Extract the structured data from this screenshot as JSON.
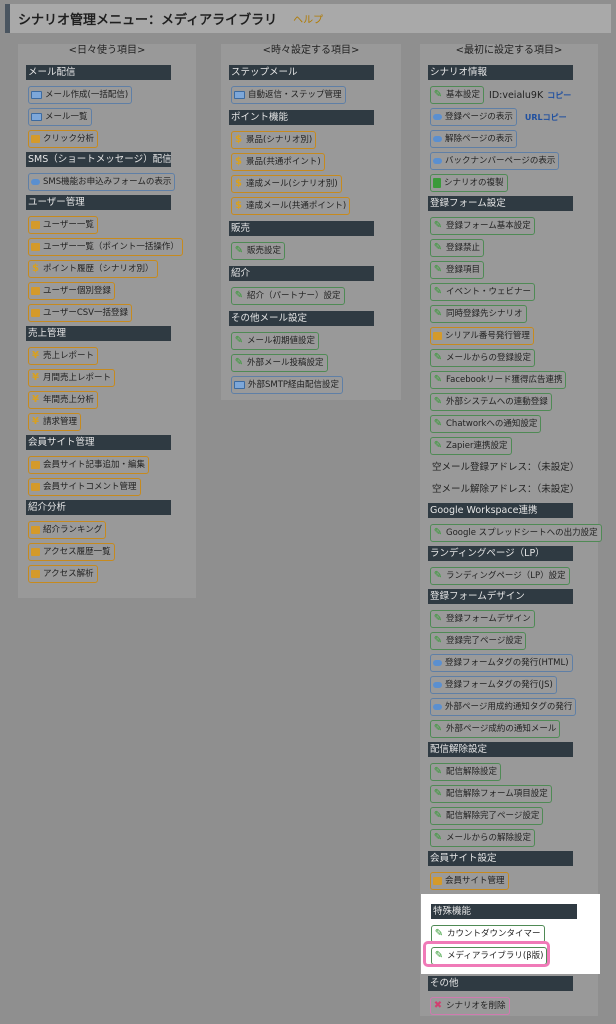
{
  "header": {
    "title": "シナリオ管理メニュー：メディアライブラリ",
    "help": "ヘルプ"
  },
  "columns": [
    {
      "heading": "<日々使う項目>",
      "sections": [
        {
          "title": "メール配信",
          "items": [
            {
              "label": "メール作成(一括配信)",
              "icon": "mail-icon",
              "style": "blue"
            },
            {
              "label": "メール一覧",
              "icon": "mail-icon",
              "style": "blue"
            },
            {
              "label": "クリック分析",
              "icon": "chart-icon",
              "style": "orange"
            }
          ]
        },
        {
          "title": "SMS（ショートメッセージ）配信",
          "items": [
            {
              "label": "SMS機能お申込みフォームの表示",
              "icon": "arrow-icon",
              "style": "blue"
            }
          ]
        },
        {
          "title": "ユーザー管理",
          "items": [
            {
              "label": "ユーザー一覧",
              "icon": "chart-icon",
              "style": "orange"
            },
            {
              "label": "ユーザー一覧（ポイント一括操作）",
              "icon": "chart-icon",
              "style": "orange"
            },
            {
              "label": "ポイント履歴（シナリオ別）",
              "icon": "dollar-icon",
              "style": "orange"
            },
            {
              "label": "ユーザー個別登録",
              "icon": "chart-icon",
              "style": "orange"
            },
            {
              "label": "ユーザーCSV一括登録",
              "icon": "chart-icon",
              "style": "orange"
            }
          ]
        },
        {
          "title": "売上管理",
          "items": [
            {
              "label": "売上レポート",
              "icon": "yen-icon",
              "style": "orange"
            },
            {
              "label": "月間売上レポート",
              "icon": "yen-icon",
              "style": "orange"
            },
            {
              "label": "年間売上分析",
              "icon": "yen-icon",
              "style": "orange"
            },
            {
              "label": "請求管理",
              "icon": "yen-icon",
              "style": "orange"
            }
          ]
        },
        {
          "title": "会員サイト管理",
          "items": [
            {
              "label": "会員サイト記事追加・編集",
              "icon": "chart-icon",
              "style": "orange"
            },
            {
              "label": "会員サイトコメント管理",
              "icon": "chart-icon",
              "style": "orange"
            }
          ]
        },
        {
          "title": "紹介分析",
          "items": [
            {
              "label": "紹介ランキング",
              "icon": "chart-icon",
              "style": "orange"
            },
            {
              "label": "アクセス履歴一覧",
              "icon": "chart-icon",
              "style": "orange"
            },
            {
              "label": "アクセス解析",
              "icon": "chart-icon",
              "style": "orange"
            }
          ]
        }
      ]
    },
    {
      "heading": "<時々設定する項目>",
      "sections": [
        {
          "title": "ステップメール",
          "items": [
            {
              "label": "自動返信・ステップ管理",
              "icon": "mail-icon",
              "style": "blue"
            }
          ]
        },
        {
          "title": "ポイント機能",
          "items": [
            {
              "label": "景品(シナリオ別)",
              "icon": "dollar-icon",
              "style": "orange"
            },
            {
              "label": "景品(共通ポイント)",
              "icon": "dollar-icon",
              "style": "orange"
            },
            {
              "label": "達成メール(シナリオ別)",
              "icon": "dollar-icon",
              "style": "orange"
            },
            {
              "label": "達成メール(共通ポイント)",
              "icon": "dollar-icon",
              "style": "orange"
            }
          ]
        },
        {
          "title": "販売",
          "items": [
            {
              "label": "販売設定",
              "icon": "pencil-icon",
              "style": "green"
            }
          ]
        },
        {
          "title": "紹介",
          "items": [
            {
              "label": "紹介（パートナー）設定",
              "icon": "pencil-icon",
              "style": "green"
            }
          ]
        },
        {
          "title": "その他メール設定",
          "items": [
            {
              "label": "メール初期値設定",
              "icon": "pencil-icon",
              "style": "green"
            },
            {
              "label": "外部メール投稿設定",
              "icon": "pencil-icon",
              "style": "green"
            },
            {
              "label": "外部SMTP経由配信設定",
              "icon": "mail-icon",
              "style": "blue"
            }
          ]
        }
      ]
    },
    {
      "heading": "<最初に設定する項目>",
      "scenario_info": {
        "title": "シナリオ情報",
        "basic": "基本設定",
        "id_text": "ID:veialu9K",
        "copy": "コピー",
        "url_copy": "URLコピー",
        "items": [
          {
            "label": "登録ページの表示",
            "icon": "arrow-icon",
            "style": "blue"
          },
          {
            "label": "解除ページの表示",
            "icon": "arrow-icon",
            "style": "blue"
          },
          {
            "label": "バックナンバーページの表示",
            "icon": "arrow-icon",
            "style": "blue"
          },
          {
            "label": "シナリオの複製",
            "icon": "doc-icon",
            "style": "green"
          }
        ]
      },
      "sections": [
        {
          "title": "登録フォーム設定",
          "items": [
            {
              "label": "登録フォーム基本設定",
              "icon": "pencil-icon",
              "style": "green"
            },
            {
              "label": "登録禁止",
              "icon": "pencil-icon",
              "style": "green"
            },
            {
              "label": "登録項目",
              "icon": "pencil-icon",
              "style": "green"
            },
            {
              "label": "イベント・ウェビナー",
              "icon": "pencil-icon",
              "style": "green"
            },
            {
              "label": "同時登録先シナリオ",
              "icon": "pencil-icon",
              "style": "green"
            },
            {
              "label": "シリアル番号発行管理",
              "icon": "chart-icon",
              "style": "orange"
            },
            {
              "label": "メールからの登録設定",
              "icon": "pencil-icon",
              "style": "green"
            },
            {
              "label": "Facebookリード獲得広告連携",
              "icon": "pencil-icon",
              "style": "green"
            },
            {
              "label": "外部システムへの連動登録",
              "icon": "pencil-icon",
              "style": "green"
            },
            {
              "label": "Chatworkへの通知設定",
              "icon": "pencil-icon",
              "style": "green"
            },
            {
              "label": "Zapier連携設定",
              "icon": "pencil-icon",
              "style": "green"
            }
          ],
          "plain": [
            "空メール登録アドレス：（未設定）",
            "空メール解除アドレス：（未設定）"
          ]
        },
        {
          "title": "Google Workspace連携",
          "items": [
            {
              "label": "Google スプレッドシートへの出力設定",
              "icon": "pencil-icon",
              "style": "green"
            }
          ]
        },
        {
          "title": "ランディングページ（LP）",
          "items": [
            {
              "label": "ランディングページ（LP）設定",
              "icon": "pencil-icon",
              "style": "green"
            }
          ]
        },
        {
          "title": "登録フォームデザイン",
          "items": [
            {
              "label": "登録フォームデザイン",
              "icon": "pencil-icon",
              "style": "green"
            },
            {
              "label": "登録完了ページ設定",
              "icon": "pencil-icon",
              "style": "green"
            },
            {
              "label": "登録フォームタグの発行(HTML)",
              "icon": "arrow-icon",
              "style": "blue"
            },
            {
              "label": "登録フォームタグの発行(JS)",
              "icon": "arrow-icon",
              "style": "blue"
            },
            {
              "label": "外部ページ用成約通知タグの発行",
              "icon": "arrow-icon",
              "style": "blue"
            },
            {
              "label": "外部ページ成約の通知メール",
              "icon": "pencil-icon",
              "style": "green"
            }
          ]
        },
        {
          "title": "配信解除設定",
          "items": [
            {
              "label": "配信解除設定",
              "icon": "pencil-icon",
              "style": "green"
            },
            {
              "label": "配信解除フォーム項目設定",
              "icon": "pencil-icon",
              "style": "green"
            },
            {
              "label": "配信解除完了ページ設定",
              "icon": "pencil-icon",
              "style": "green"
            },
            {
              "label": "メールからの解除設定",
              "icon": "pencil-icon",
              "style": "green"
            }
          ]
        },
        {
          "title": "会員サイト設定",
          "items": [
            {
              "label": "会員サイト管理",
              "icon": "chart-icon",
              "style": "orange"
            }
          ]
        }
      ],
      "special": {
        "title": "特殊機能",
        "items": [
          {
            "label": "カウントダウンタイマー",
            "icon": "pencil-icon",
            "style": "green"
          },
          {
            "label": "メディアライブラリ(β版)",
            "icon": "pencil-icon",
            "style": "green"
          }
        ]
      },
      "other": {
        "title": "その他",
        "items": [
          {
            "label": "シナリオを削除",
            "icon": "x-icon",
            "style": "pink"
          }
        ]
      }
    }
  ]
}
